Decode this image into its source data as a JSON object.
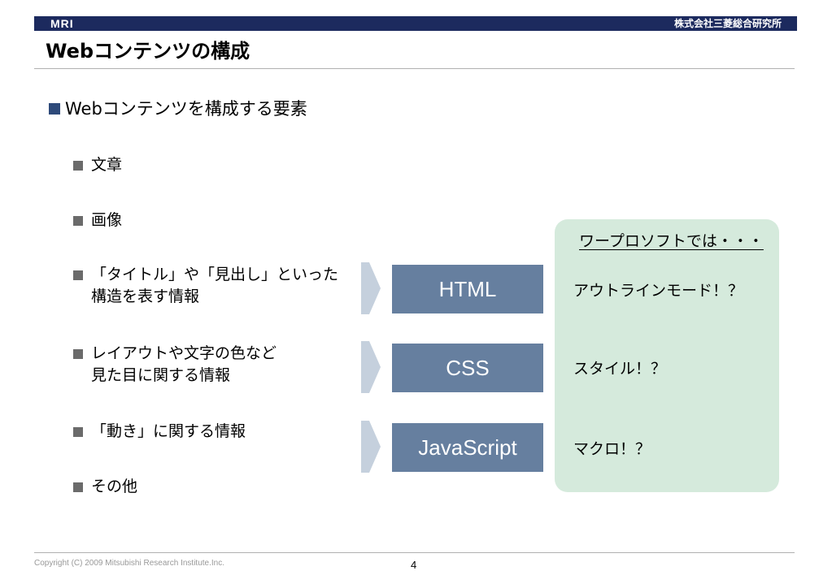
{
  "header": {
    "logo": "MRI",
    "company": "株式会社三菱総合研究所",
    "title": "Webコンテンツの構成",
    "brand_color": "#1c2a5e"
  },
  "main": {
    "heading": "Webコンテンツを構成する要素",
    "items": [
      {
        "lines": [
          "文章"
        ]
      },
      {
        "lines": [
          "画像"
        ]
      },
      {
        "lines": [
          "「タイトル」や「見出し」といった",
          "構造を表す情報"
        ]
      },
      {
        "lines": [
          "レイアウトや文字の色など",
          "見た目に関する情報"
        ]
      },
      {
        "lines": [
          "「動き」に関する情報"
        ]
      },
      {
        "lines": [
          "その他"
        ]
      }
    ]
  },
  "tech_boxes": [
    {
      "label": "HTML"
    },
    {
      "label": "CSS"
    },
    {
      "label": "JavaScript"
    }
  ],
  "word_processor": {
    "heading": "ワープロソフトでは・・・",
    "lines": [
      "アウトラインモード！？",
      "スタイル！？",
      "マクロ！？"
    ]
  },
  "footer": {
    "copyright": "Copyright (C) 2009 Mitsubishi Research Institute.Inc.",
    "page": "4"
  },
  "colors": {
    "box_fill": "#667f9f",
    "green_panel": "#d5eadc",
    "chevron": "#c5d0dd"
  },
  "icons": [
    "square-bullet-icon",
    "chevron-right-icon"
  ]
}
